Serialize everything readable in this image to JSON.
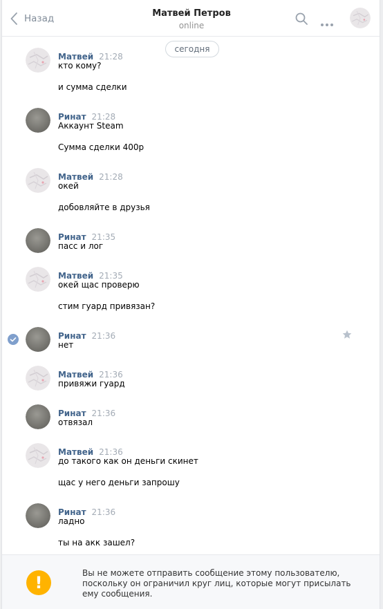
{
  "header": {
    "back_label": "Назад",
    "title": "Матвей Петров",
    "status": "online"
  },
  "date_pill": "сегодня",
  "messages": [
    {
      "author": "Матвей",
      "time": "21:28",
      "lines": [
        "кто кому?",
        "и сумма сделки"
      ]
    },
    {
      "author": "Ринат",
      "time": "21:28",
      "lines": [
        "Аккаунт Steam",
        "Сумма сделки 400р"
      ]
    },
    {
      "author": "Матвей",
      "time": "21:28",
      "lines": [
        "окей",
        "добовляйте в друзья"
      ]
    },
    {
      "author": "Ринат",
      "time": "21:35",
      "lines": [
        "пасс и лог"
      ]
    },
    {
      "author": "Матвей",
      "time": "21:35",
      "lines": [
        "окей щас проверю",
        "стим гуард привязан?"
      ]
    },
    {
      "author": "Ринат",
      "time": "21:36",
      "lines": [
        "нет"
      ]
    },
    {
      "author": "Матвей",
      "time": "21:36",
      "lines": [
        "привяжи гуард"
      ]
    },
    {
      "author": "Ринат",
      "time": "21:36",
      "lines": [
        "отвязал"
      ]
    },
    {
      "author": "Матвей",
      "time": "21:36",
      "lines": [
        "до такого как он деньги скинет",
        "щас у него деньги запрошу"
      ]
    },
    {
      "author": "Ринат",
      "time": "21:36",
      "lines": [
        "ладно",
        "ты на акк зашел?"
      ]
    }
  ],
  "notice": {
    "icon_glyph": "!",
    "text": "Вы не можете отправить сообщение этому пользователю, поскольку он ограничил круг лиц, которые могут присылать ему сообщения."
  },
  "colors": {
    "author": "#42648b",
    "time": "#a3abb5",
    "accent": "#5181b8",
    "warning": "#ffb300"
  }
}
